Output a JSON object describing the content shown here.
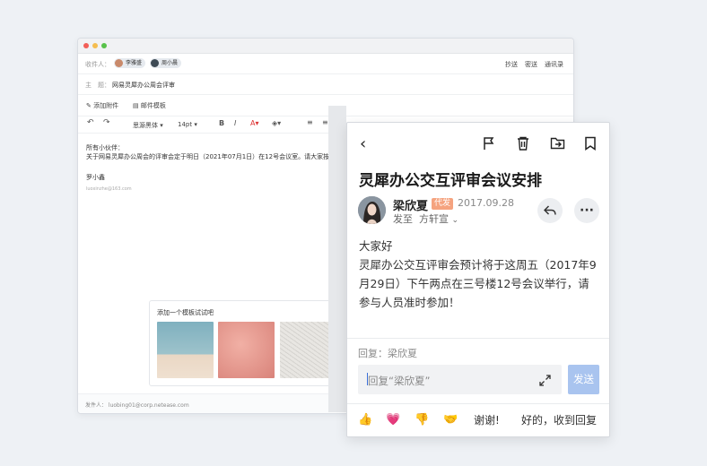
{
  "compose": {
    "to_label": "收件人：",
    "recipients": [
      "李雅盛",
      "周小晨"
    ],
    "right_links": [
      "抄送",
      "密送",
      "通讯录"
    ],
    "subject_label": "主　题：",
    "subject": "网易灵犀办公周会评审",
    "attach_label": "添加附件",
    "template_label": "邮件模板",
    "font_name": "思源黑体",
    "font_size": "14pt",
    "body_line1": "所有小伙伴：",
    "body_line2": "关于网易灵犀办公周会的评审会定于明日（2021年07月1日）在12号会议室。请大家按时参...",
    "signature_name": "罗小鑫",
    "signature_email": "luoxinzhe@163.com",
    "template_prompt": "添加一个模板试试吧",
    "footer_sender": "发件人：  luobing01@corp.netease.com"
  },
  "card": {
    "title": "灵犀办公交互评审会议安排",
    "sender_name": "梁欣夏",
    "badge": "代发",
    "date": "2017.09.28",
    "send_label": "发至",
    "recipient": "方轩宣",
    "greeting": "大家好",
    "body": "灵犀办公交互评审会预计将于这周五（2017年9月29日）下午两点在三号楼12号会议举行，请参与人员准时参加！",
    "reply_to": "回复：梁欣夏",
    "reply_placeholder": "回复“梁欣夏”",
    "send_button": "发送",
    "quick_replies": [
      "谢谢!",
      "好的，收到回复"
    ]
  },
  "icons": {
    "back": "chevron-left-icon",
    "flag": "flag-icon",
    "trash": "trash-icon",
    "move": "move-to-folder-icon",
    "bookmark": "bookmark-icon",
    "reply": "reply-icon",
    "more": "more-icon",
    "expand": "expand-icon",
    "emojis": [
      "thumbs-up-icon",
      "heart-icon",
      "thumbs-down-icon",
      "handshake-icon"
    ]
  },
  "colors": {
    "badge": "#f5a37f",
    "send_button": "#a9c4ef",
    "background": "#eef1f5"
  }
}
